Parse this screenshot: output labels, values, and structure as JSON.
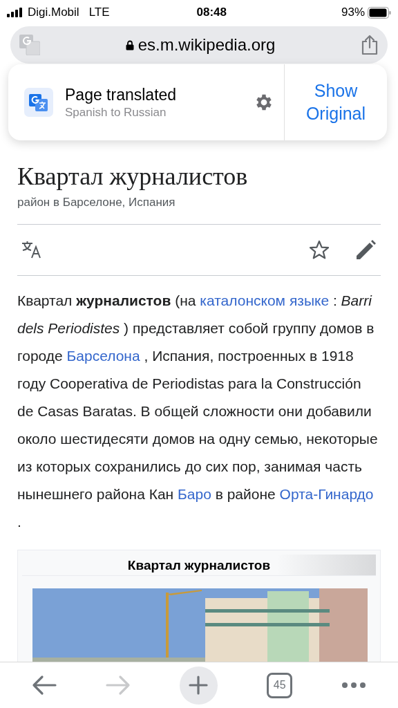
{
  "status_bar": {
    "carrier": "Digi.Mobil",
    "network": "LTE",
    "time": "08:48",
    "battery": "93%"
  },
  "address_bar": {
    "url": "es.m.wikipedia.org"
  },
  "translate_banner": {
    "title": "Page translated",
    "subtitle": "Spanish to Russian",
    "action": "Show Original"
  },
  "article": {
    "title": "Квартал журналистов",
    "subtitle": "район в Барселоне, Испания",
    "paragraph": [
      {
        "kind": "text",
        "text": "Квартал **журналистов** (на "
      },
      {
        "kind": "link",
        "text": "каталонском языке"
      },
      {
        "kind": "text",
        "text": " : *Barri dels Periodistes* ) представляет собой группу домов в городе "
      },
      {
        "kind": "link",
        "text": "Барселона"
      },
      {
        "kind": "text",
        "text": " , Испания, построенных в 1918 году Cooperativa de Periodistas para la Construcción de Casas Baratas. В общей сложности они добавили около шестидесяти домов на одну семью, некоторые из которых сохранились до сих пор, занимая часть нынешнего района Кан "
      },
      {
        "kind": "link",
        "text": "Баро"
      },
      {
        "kind": "text",
        "text": " в районе "
      },
      {
        "kind": "link",
        "text": "Орта-Гинардо"
      },
      {
        "kind": "text",
        "text": " ."
      }
    ],
    "infobox": {
      "title": "Квартал журналистов"
    }
  },
  "toolbar": {
    "forward_disabled": true,
    "tab_count": "45"
  }
}
